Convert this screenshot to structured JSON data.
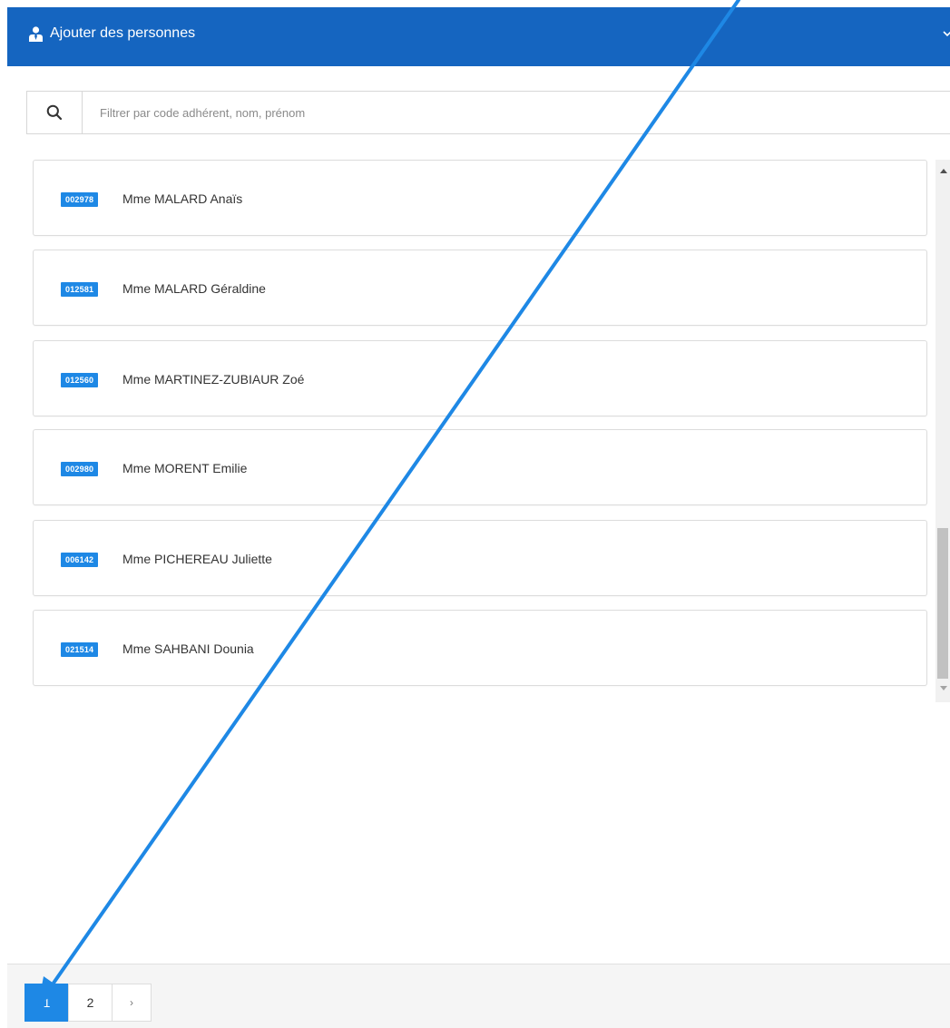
{
  "header": {
    "title": "Ajouter des personnes",
    "icon": "user-tie-icon",
    "color": "#1565c0"
  },
  "search": {
    "icon": "search-icon",
    "placeholder": "Filtrer par code adhérent, nom, prénom",
    "value": ""
  },
  "people": [
    {
      "code": "002978",
      "name": "Mme MALARD Anaïs"
    },
    {
      "code": "012581",
      "name": "Mme MALARD Géraldine"
    },
    {
      "code": "012560",
      "name": "Mme MARTINEZ-ZUBIAUR Zoé"
    },
    {
      "code": "002980",
      "name": "Mme MORENT Emilie"
    },
    {
      "code": "006142",
      "name": "Mme PICHEREAU Juliette"
    },
    {
      "code": "021514",
      "name": "Mme SAHBANI Dounia"
    }
  ],
  "pagination": {
    "pages": [
      "1",
      "2"
    ],
    "current": "1",
    "next_label": "›"
  },
  "colors": {
    "badge": "#1e88e5",
    "active_page": "#1e88e5",
    "annotation_arrow": "#1e88e5"
  }
}
